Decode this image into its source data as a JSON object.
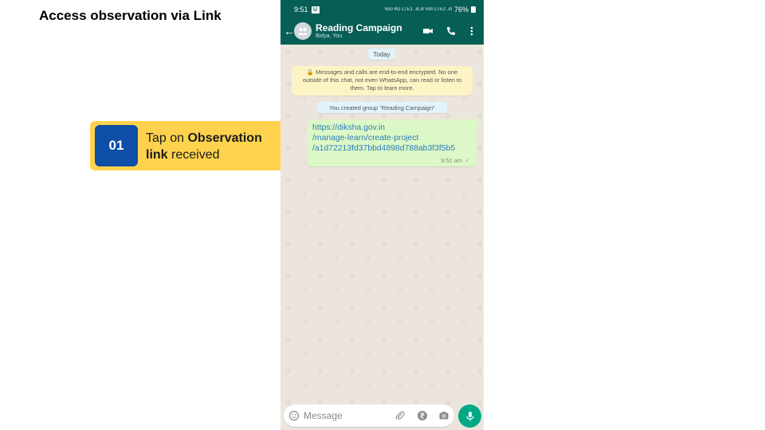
{
  "slide": {
    "title": "Access observation via Link"
  },
  "callout": {
    "step_number": "01",
    "text_plain_1": "Tap on ",
    "text_bold_1": "Observation",
    "text_bold_2": "link",
    "text_plain_2": " received",
    "color": "#ffd24d",
    "badge_color": "#0d4ea6"
  },
  "phone": {
    "status_bar": {
      "time": "9:51",
      "badge": "U",
      "signal_text": "Vo0 4G LTE1 .ıll.ıll Vo0 LTE2 .ıll",
      "battery": "76%"
    },
    "chat_header": {
      "name": "Reading Campaign",
      "members": "Bidya, You",
      "header_color": "#075e54"
    },
    "chat": {
      "date_label": "Today",
      "encryption_notice": "🔒 Messages and calls are end-to-end encrypted. No one outside of this chat, not even WhatsApp, can read or listen to them. Tap to learn more.",
      "group_created": "You created group \"Reading Campaign\"",
      "message": {
        "link_lines": [
          "https://diksha.gov.in",
          "/manage-learn/create-project",
          "/a1d72213fd37bbd4898d788ab3f3f5b5"
        ],
        "time": "9:51 am",
        "status_icon": "single-check-icon",
        "bubble_color": "#dcf8c6"
      }
    },
    "composer": {
      "placeholder": "Message",
      "icons": [
        "emoji-icon",
        "attach-icon",
        "rupee-icon",
        "camera-icon",
        "mic-icon"
      ],
      "mic_color": "#00a884"
    }
  }
}
